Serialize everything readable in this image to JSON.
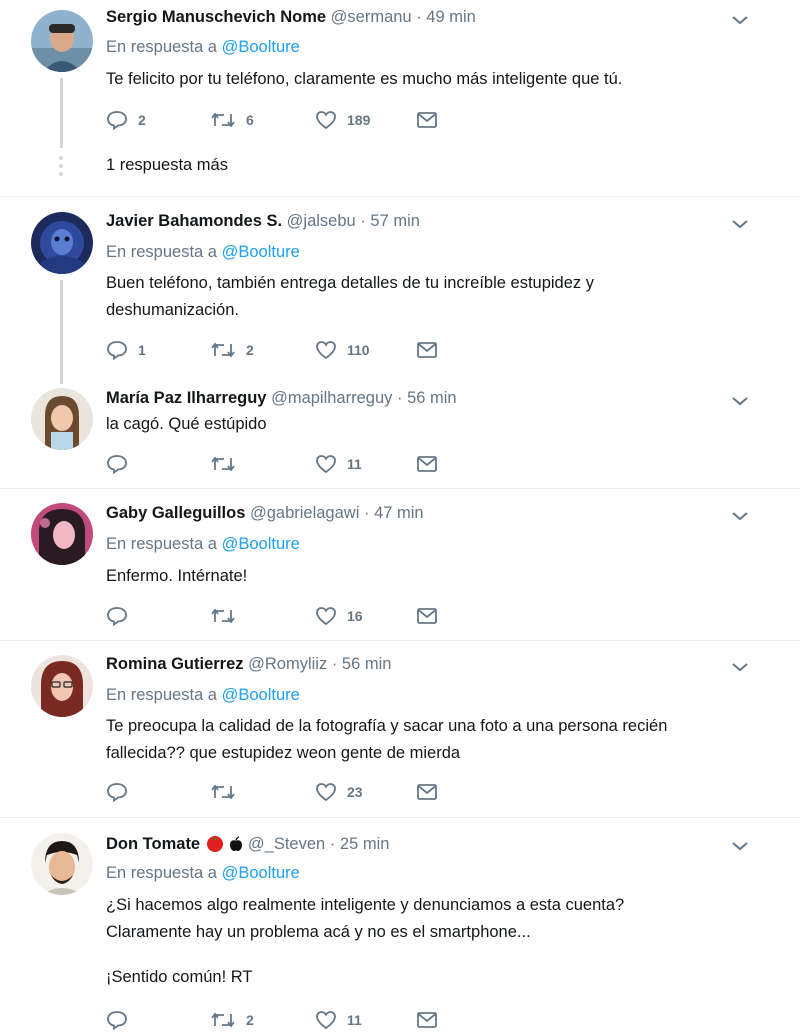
{
  "tweets": [
    {
      "name": "Sergio Manuschevich Nome",
      "handle": "@sermanu",
      "time": "49 min",
      "reply_prefix": "En respuesta a",
      "reply_to": "@Boolture",
      "text_lines": [
        "Te felicito por tu teléfono,  claramente es mucho más inteligente que tú."
      ],
      "replies": "2",
      "retweets": "6",
      "likes": "189",
      "show_more": "1 respuesta más"
    },
    {
      "name": "Javier Bahamondes S.",
      "handle": "@jalsebu",
      "time": "57 min",
      "reply_prefix": "En respuesta a",
      "reply_to": "@Boolture",
      "text_lines": [
        "Buen teléfono, también entrega detalles de tu increíble estupidez y",
        "deshumanización."
      ],
      "replies": "1",
      "retweets": "2",
      "likes": "110"
    },
    {
      "name": "María Paz Ilharreguy",
      "handle": "@mapilharreguy",
      "time": "56 min",
      "text_lines": [
        "la cagó. Qué estúpido"
      ],
      "replies": "",
      "retweets": "",
      "likes": "11"
    },
    {
      "name": "Gaby Galleguillos",
      "handle": "@gabrielagawi",
      "time": "47 min",
      "reply_prefix": "En respuesta a",
      "reply_to": "@Boolture",
      "text_lines": [
        "Enfermo. Intérnate!"
      ],
      "replies": "",
      "retweets": "",
      "likes": "16"
    },
    {
      "name": "Romina Gutierrez",
      "handle": "@Romyliiz",
      "time": "56 min",
      "reply_prefix": "En respuesta a",
      "reply_to": "@Boolture",
      "text_lines": [
        "Te preocupa la calidad de la fotografía y sacar una foto a una persona recién",
        "fallecida?? que estupidez weon gente de mierda"
      ],
      "replies": "",
      "retweets": "",
      "likes": "23"
    },
    {
      "name": "Don Tomate",
      "handle": "@_Steven",
      "time": "25 min",
      "reply_prefix": "En respuesta a",
      "reply_to": "@Boolture",
      "text_lines": [
        "¿Si hacemos algo realmente inteligente y denunciamos a esta cuenta?",
        "Claramente hay un problema acá y no es el smartphone...",
        "",
        "¡Sentido común! RT"
      ],
      "replies": "",
      "retweets": "2",
      "likes": "11"
    }
  ],
  "separator": "·",
  "icons": {
    "reply": "reply-icon",
    "retweet": "retweet-icon",
    "like": "heart-icon",
    "dm": "envelope-icon",
    "more": "chevron-down-icon",
    "emoji_1": "tomato-emoji",
    "emoji_2": "apple-icon"
  },
  "colors": {
    "text": "#14171a",
    "secondary": "#657786",
    "mention": "#1da1f2",
    "divider": "#e6ecf0",
    "thread_line": "#ccd6dd"
  }
}
